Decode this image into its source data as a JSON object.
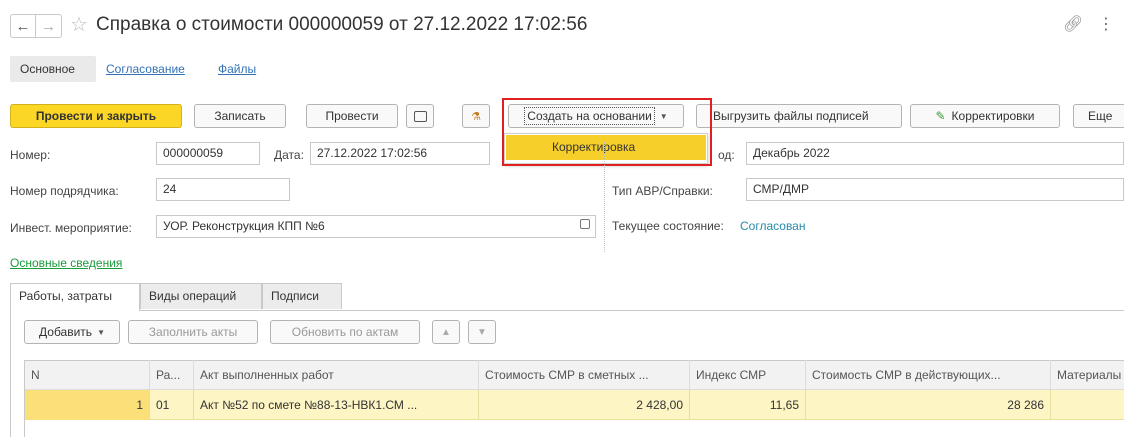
{
  "window": {
    "title": "Справка о стоимости 000000059 от 27.12.2022 17:02:56"
  },
  "section_tabs": [
    "Основное",
    "Согласование",
    "Файлы"
  ],
  "toolbar": {
    "post_close": "Провести и закрыть",
    "save": "Записать",
    "post": "Провести",
    "create_based_on": "Создать на основании",
    "export_signatures": "Выгрузить файлы подписей",
    "corrections": "Корректировки",
    "more": "Еще",
    "dropdown_item": "Корректировка"
  },
  "form": {
    "number_label": "Номер:",
    "number_value": "000000059",
    "date_label": "Дата:",
    "date_value": "27.12.2022 17:02:56",
    "contractor_no_label": "Номер подрядчика:",
    "contractor_no_value": "24",
    "invest_label": "Инвест. мероприятие:",
    "invest_value": "УОР. Реконструкция КПП №6",
    "period_label": "од:",
    "period_value": "Декабрь 2022",
    "type_label": "Тип АВР/Справки:",
    "type_value": "СМР/ДМР",
    "state_label": "Текущее состояние:",
    "state_value": "Согласован",
    "basic_info_link": "Основные сведения"
  },
  "tabs": [
    "Работы, затраты",
    "Виды операций",
    "Подписи"
  ],
  "table_toolbar": {
    "add": "Добавить",
    "fill_acts": "Заполнить акты",
    "refresh_acts": "Обновить по актам"
  },
  "table": {
    "columns": [
      "N",
      "Ра...",
      "Акт выполненных работ",
      "Стоимость СМР в сметных ...",
      "Индекс СМР",
      "Стоимость СМР в действующих...",
      "Материалы"
    ],
    "rows": [
      [
        "1",
        "01",
        "Акт №52 по смете №88-13-НВК1.СМ ...",
        "2 428,00",
        "11,65",
        "28 286",
        ""
      ]
    ]
  },
  "colors": {
    "primary_button": "#fbd624",
    "selected_row": "#fdf5c4",
    "highlight_box": "#e02020",
    "link": "#3371b5",
    "green_link": "#1a9b3c"
  }
}
